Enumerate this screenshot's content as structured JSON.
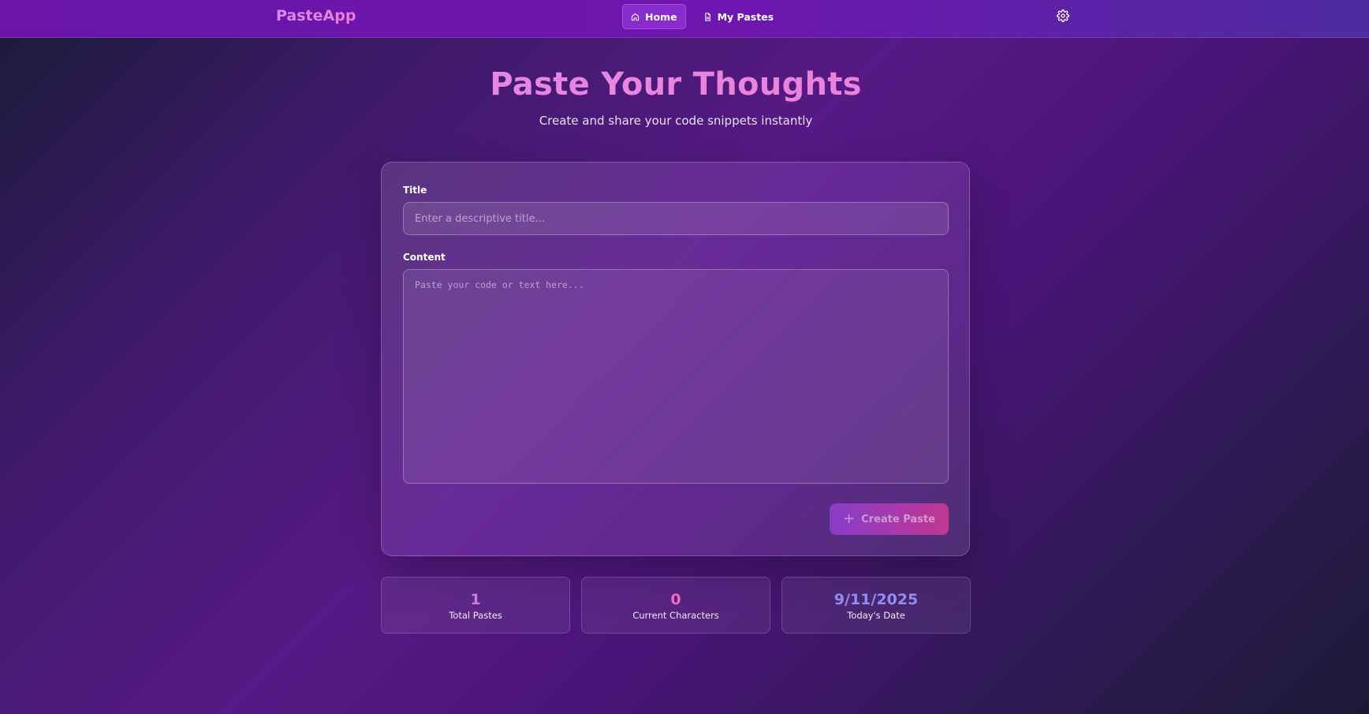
{
  "nav": {
    "brand": "PasteApp",
    "links": [
      {
        "label": "Home",
        "icon": "home-icon",
        "active": true
      },
      {
        "label": "My Pastes",
        "icon": "document-icon",
        "active": false
      }
    ],
    "settings_icon": "gear-icon"
  },
  "hero": {
    "title": "Paste Your Thoughts",
    "subtitle": "Create and share your code snippets instantly"
  },
  "form": {
    "title_label": "Title",
    "title_placeholder": "Enter a descriptive title...",
    "title_value": "",
    "content_label": "Content",
    "content_placeholder": "Paste your code or text here...",
    "content_value": "",
    "create_button": "Create Paste",
    "create_icon": "plus-icon"
  },
  "stats": [
    {
      "value": "1",
      "label": "Total Pastes",
      "color": "#c77cf0"
    },
    {
      "value": "0",
      "label": "Current Characters",
      "color": "#f06bbd"
    },
    {
      "value": "9/11/2025",
      "label": "Today's Date",
      "color": "#8e8cf5"
    }
  ],
  "colors": {
    "accent_purple": "#6d17b0",
    "gradient_pink": "#f07ad1",
    "button_start": "#8b3fd0",
    "button_end": "#cc3a92"
  }
}
